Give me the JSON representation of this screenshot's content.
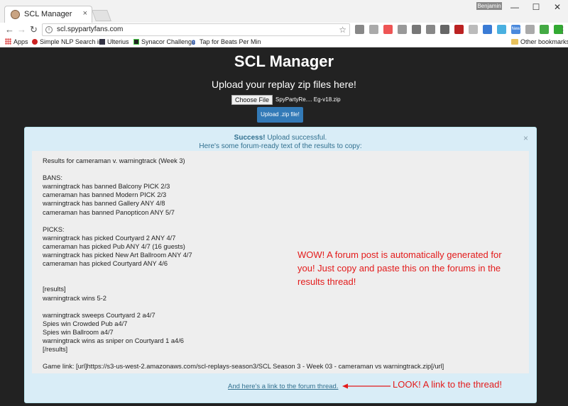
{
  "browser": {
    "tab_title": "SCL Manager",
    "tab_close": "×",
    "user_chip": "Benjamin",
    "window_controls": {
      "minimize": "—",
      "maximize": "☐",
      "close": "✕"
    },
    "url": "scl.spypartyfans.com",
    "bookmarks": [
      {
        "label": "Apps",
        "icon": "apps-icon"
      },
      {
        "label": "Simple NLP Search in",
        "icon": "nlp-icon"
      },
      {
        "label": "Ulterius",
        "icon": "ulterius-icon"
      },
      {
        "label": "Synacor Challenge",
        "icon": "synacor-icon"
      },
      {
        "label": "Tap for Beats Per Min",
        "icon": "bpm-icon"
      }
    ],
    "other_bookmarks": "Other bookmarks",
    "extensions_new_badge": "New"
  },
  "page": {
    "title": "SCL Manager",
    "subtitle": "Upload your replay zip files here!",
    "choose_file_label": "Choose File",
    "file_name": "SpyPartyRe.... Eg-v18.zip",
    "upload_button": "Upload .zip file!"
  },
  "alert": {
    "close": "×",
    "success_strong": "Success!",
    "success_text": " Upload successful.",
    "line2": "Here's some forum-ready text of the results to copy:",
    "results": "Results for cameraman v. warningtrack (Week 3)\n\nBANS:\nwarningtrack has banned Balcony PICK 2/3\ncameraman has banned Modern PICK 2/3\nwarningtrack has banned Gallery ANY 4/8\ncameraman has banned Panopticon ANY 5/7\n\nPICKS:\nwarningtrack has picked Courtyard 2 ANY 4/7\ncameraman has picked Pub ANY 4/7 (16 guests)\nwarningtrack has picked New Art Ballroom ANY 4/7\ncameraman has picked Courtyard ANY 4/6\n\n\n[results]\nwarningtrack wins 5-2\n\nwarningtrack sweeps Courtyard 2 a4/7\nSpies win Crowded Pub a4/7\nSpies win Ballroom a4/7\nwarningtrack wins as sniper on Courtyard 1 a4/6\n[/results]\n\nGame link: [url]https://s3-us-west-2.amazonaws.com/scl-replays-season3/SCL Season 3 - Week 03 - cameraman vs warningtrack.zip[/url]",
    "forum_link": "And here's a link to the forum thread."
  },
  "annotations": {
    "wow": "WOW! A forum post is automatically generated for you! Just copy and paste this on the forums in the results thread!",
    "look": "LOOK! A link to the thread!",
    "color": "#e31b1b"
  }
}
